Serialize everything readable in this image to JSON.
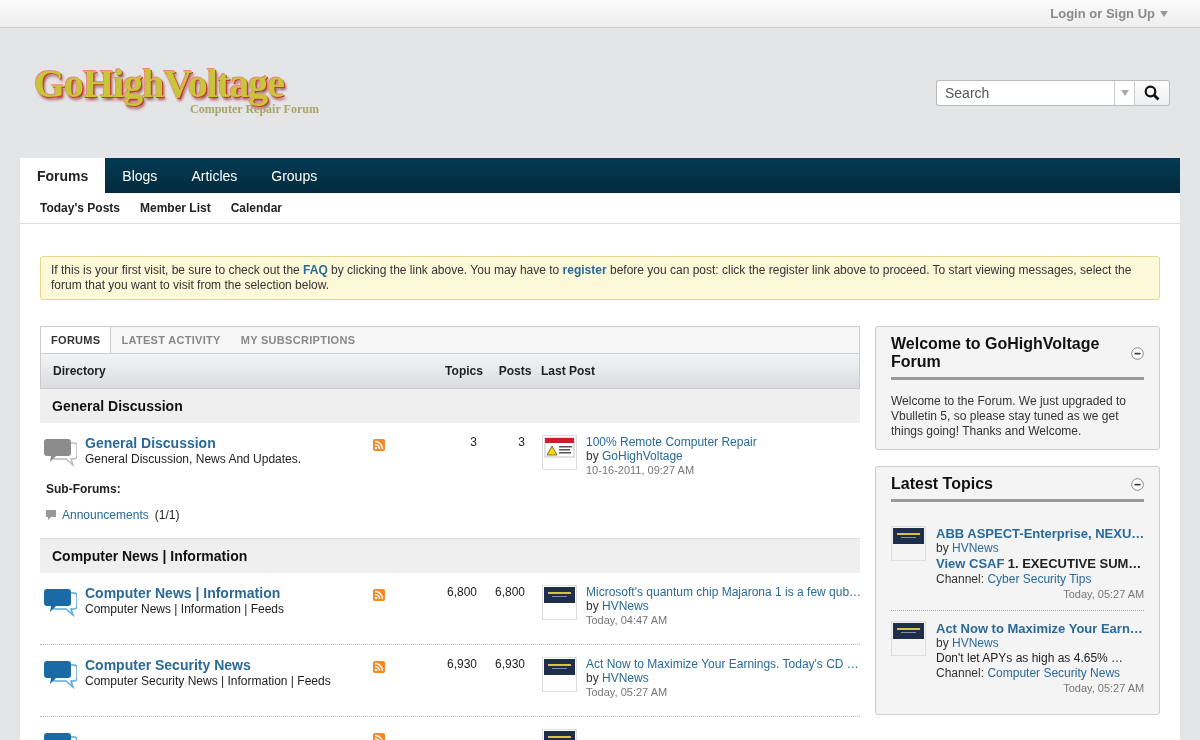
{
  "top_bar": {
    "login": "Login or Sign Up"
  },
  "logo": {
    "title": "GoHighVoltage",
    "subtitle": "Computer Repair Forum"
  },
  "search": {
    "placeholder": "Search"
  },
  "nav": {
    "tabs": [
      {
        "label": "Forums",
        "selected": true
      },
      {
        "label": "Blogs",
        "selected": false
      },
      {
        "label": "Articles",
        "selected": false
      },
      {
        "label": "Groups",
        "selected": false
      }
    ],
    "sub_links": [
      "Today's Posts",
      "Member List",
      "Calendar"
    ]
  },
  "notice": [
    {
      "kind": "text",
      "text": "If this is your first visit, be sure to check out the "
    },
    {
      "kind": "link",
      "text": "FAQ"
    },
    {
      "kind": "text",
      "text": " by clicking the link above. You may have to "
    },
    {
      "kind": "link",
      "text": "register"
    },
    {
      "kind": "text",
      "text": " before you can post: click the register link above to proceed. To start viewing messages, select the forum that you want to visit from the selection below."
    }
  ],
  "forum_tabs": [
    {
      "label": "FORUMS",
      "selected": true
    },
    {
      "label": "LATEST ACTIVITY",
      "selected": false
    },
    {
      "label": "MY SUBSCRIPTIONS",
      "selected": false
    }
  ],
  "columns": [
    "Directory",
    "Topics",
    "Posts",
    "Last Post"
  ],
  "categories": [
    {
      "title": "General Discussion",
      "forums": [
        {
          "title": "General Discussion",
          "description": "General Discussion, News And Updates.",
          "new_posts": false,
          "topics": "3",
          "posts": "3",
          "last_post": {
            "kind": "danger",
            "title": "100% Remote Computer Repair",
            "by": "by",
            "author": "GoHighVoltage",
            "date": "10-16-2011, 09:27 AM"
          }
        }
      ],
      "subforums_label": "Sub-Forums:",
      "subforums": [
        {
          "title": "Announcements",
          "count": "(1/1)"
        }
      ]
    },
    {
      "title": "Computer News | Information",
      "forums": [
        {
          "title": "Computer News | Information",
          "description": "Computer News | Information | Feeds",
          "new_posts": true,
          "topics": "6,800",
          "posts": "6,800",
          "last_post": {
            "kind": "banner",
            "title": "Microsoft's quantum chip Majarona 1 is a few qub…",
            "by": "by",
            "author": "HVNews",
            "date": "Today, 04:47 AM"
          }
        },
        {
          "title": "Computer Security News",
          "description": "Computer Security News | Information | Feeds",
          "new_posts": true,
          "topics": "6,930",
          "posts": "6,930",
          "last_post": {
            "kind": "banner",
            "title": "Act Now to Maximize Your Earnings. Today's CD …",
            "by": "by",
            "author": "HVNews",
            "date": "Today, 05:27 AM"
          }
        },
        {
          "new_posts": true,
          "last_post": {
            "kind": "banner"
          }
        }
      ]
    }
  ],
  "sidebar": [
    {
      "kind": "text",
      "title": "Welcome to GoHighVoltage Forum",
      "body": "Welcome to the Forum. We just upgraded to Vbulletin 5, so please stay tuned as we get things going! Thanks and Welcome."
    },
    {
      "kind": "topics",
      "title": "Latest Topics",
      "items": [
        {
          "title": "ABB ASPECT-Enterprise, NEXU…",
          "by": "by",
          "author": "HVNews",
          "preview_link": "View CSAF",
          "preview": "1. EXECUTIVE SUM…",
          "preview_bold": true,
          "channel_label": "Channel:",
          "channel": "Cyber Security Tips",
          "date": "Today, 05:27 AM"
        },
        {
          "title": "Act Now to Maximize Your Earn…",
          "by": "by",
          "author": "HVNews",
          "preview": "Don't let APYs as high as 4.65% …",
          "preview_bold": false,
          "channel_label": "Channel:",
          "channel": "Computer Security News",
          "date": "Today, 05:27 AM"
        }
      ]
    }
  ]
}
